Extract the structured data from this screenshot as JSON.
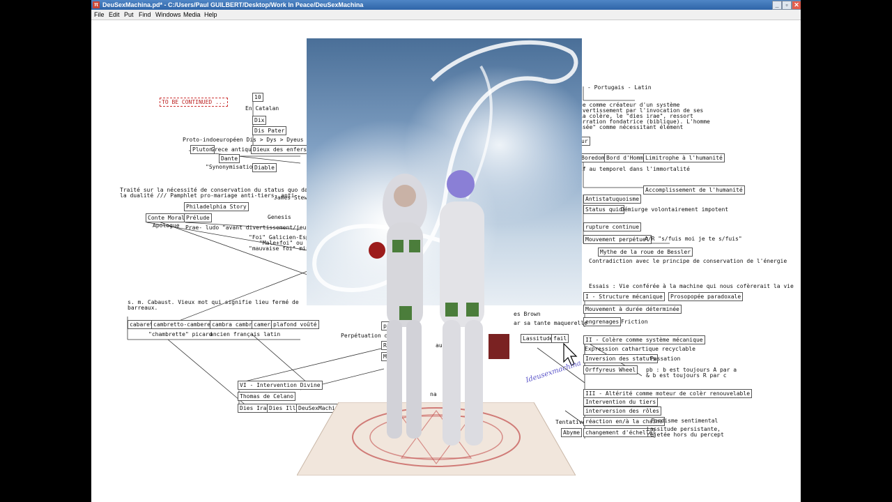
{
  "window": {
    "app_icon": "pd-icon",
    "title": "DeuSexMachina.pd* - C:/Users/Paul GUILBERT/Desktop/Work In Peace/DeuSexMachina",
    "minimize": "_",
    "maximize": "▫",
    "close": "✕"
  },
  "menu": [
    "File",
    "Edit",
    "Put",
    "Find",
    "Windows",
    "Media",
    "Help"
  ],
  "left": {
    "to_be_continued": "TO BE CONTINUED ...",
    "n10": "10",
    "en_catalan": "En Catalan",
    "dix": "Dix",
    "dis_pater": "Dis Pater",
    "proto": "Proto-indoeuropéen Dis > Dys > Dyeus > dieu",
    "pluton": "Pluton",
    "grece": "Grece antique",
    "dieux_enfers": "Dieux des enfers",
    "dante": "Dante",
    "synonymisation": "\"Synonymisation\"",
    "diable": "Diable",
    "traite1": "Traité sur la nécessité de conservation du status quo dans",
    "traite2": "la dualité /// Pamphlet pro-mariage anti-tiers, anti-",
    "james": "James Stewar",
    "philadelphia": "Philadelphia Story",
    "genesis": "Genesis",
    "conte_moral": "Conte Moral",
    "prelude": "Prélude",
    "apologue": "Apologue",
    "prae": "Prae- ludo \"avant divertissement/jeu/ébat.",
    "foi1": "\"Foi\" Galicien-Espag",
    "foi2": "\"Male+foi\" ou \"fo",
    "foi3": "\"mauvaise foi\" misogy",
    "cabaust1": "s. m. Cabaust. Vieux mot qui signifie lieu fermé de",
    "cabaust2": "barreaux.",
    "cabaret": "cabaret",
    "cambretto": "cambretto-camberete",
    "cambra": "cambra cambre",
    "camera": "camera",
    "plafond": "plafond voûté",
    "chambrette": "\"chambrette\" picard",
    "ancien": "ancien français latin",
    "perpetuation": "Perpétuation de",
    "pu": "pu",
    "re": "R e",
    "meca": "Méca",
    "vi": "VI - Intervention Divine",
    "thomas": "Thomas de Celano",
    "dies_irae": "Dies Irae",
    "dies_illa": "Dies Illa",
    "deusex": "DeuSexMachina",
    "aus": "aus",
    "na": "na"
  },
  "right": {
    "portugais": "- Portugais - Latin",
    "ue1": "ue comme créateur d'un système",
    "ue2": "ivertissement par l'invocation de ses",
    "ue3": "La colère, le \"dies irae\", ressort",
    "ue4": "arration fondatrice (biblique). L'homme",
    "ue5": "nsée\" comme nécessitant élément",
    "ur": "ur",
    "boredom": "Boredom",
    "bord": "Bord d'Homme",
    "limitrophe": "Limitrophe à l'humanité",
    "if_temporel": "if au temporel dans l'immortalité",
    "accomplissement": "Accomplissement de l'humanité",
    "antistat": "Antistatuquoisme",
    "status_quid": "Status quid",
    "demiurge": "Démiurge volontairement impotent",
    "rupture": "rupture continue",
    "mouvement": "Mouvement perpétuel",
    "ar": "A/R \"s/fuis moi je te s/fuis\"",
    "mythe": "Mythe de la roue de Bessler",
    "contradiction": "Contradiction avec le principe de conservation de l'énergie",
    "essais": "Essais :  Vie conférée à la machine qui nous cofèrerait la vie",
    "structure": "I - Structure mécanique",
    "prosopopee": "Prosopopée paradoxale",
    "duree": "Mouvement à durée déterminée",
    "engrenages": "engrenages",
    "friction": "Friction",
    "es_brown": "es Brown",
    "maquerelle": "ar sa tante maquerelle",
    "lassitude": "Lassitude",
    "fail": "fail",
    "colere": "II - Colère comme système mécanique",
    "cathartique": "Expression cathartique recyclable",
    "inversion": "Inversion des statuts",
    "passation": "Passation",
    "orffyreus": "Orffyreus Wheel",
    "pb1": "pb : b est toujours A par a",
    "pb2": "& b est toujours R par c",
    "alterite": "III - Altérité comme moteur de colèr renouvelable",
    "intervention_tiers": "Intervention du tiers",
    "interversion": "interversion des rôles",
    "tentative": "Tentative",
    "reaction": "réaction en/à la chaîne",
    "fordisme": "Fordisme sentimental",
    "abyme": "Abyme",
    "changement": "changement d'échelle",
    "lassitude_p": "Lassitude persistante,",
    "rejetee": "rejetée hors du percept"
  },
  "overlay": {
    "signature": "Ideusexmachina"
  }
}
